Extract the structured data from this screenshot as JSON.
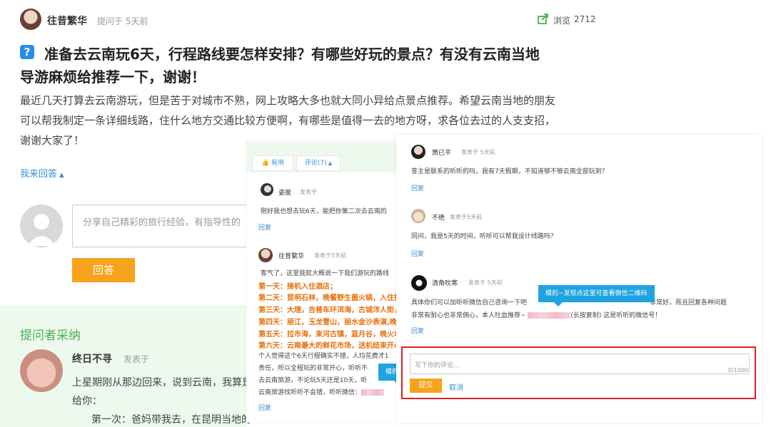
{
  "question": {
    "author": "往昔繁华",
    "asked_time": "提问于 5天前",
    "views_label": "浏览",
    "views_count": "2712",
    "title_line1": "准备去云南玩6天，行程路线要怎样安排？有哪些好玩的景点？有没有云南当地",
    "title_line2": "导游麻烦给推荐一下，谢谢！",
    "body_line1": "最近几天打算去云南游玩，但是苦于对城市不熟，网上攻略大多也就大同小异给点景点推荐。希望云南当地的朋友",
    "body_line2": "可以帮我制定一条详细线路，住什么地方交通比较方便啊，有哪些是值得一去的地方呀，求各位去过的人支支招，",
    "body_line3": "谢谢大家了！",
    "answer_toggle": "我来回答",
    "answer_placeholder": "分享自己精彩的旅行经验，有指导性的",
    "answer_button": "回答"
  },
  "adopted": {
    "section_title": "提问者采纳",
    "author": "终日不寻",
    "time": "发表于",
    "line1": "上星期刚从那边回来，说到云南，我算是",
    "line2": "给你：",
    "line3": "第一次：爸妈带我去，在昆明当地的"
  },
  "middle_panel": {
    "useful_label": "有用",
    "comments_label": "评论(7)",
    "c1": {
      "author": "姿度",
      "time": "发表于",
      "text": "刚好我也想去玩6天，能把你第二次去云南的",
      "reply": "回复"
    },
    "c2": {
      "author": "往昔繁华",
      "time": "发表于5天前",
      "intro": "客气了，这里我就大概说一下我们游玩的路线",
      "days": [
        "第一天：接机入住酒店；",
        "第二天：昆明石林，晚餐野生菌火锅，入住楚",
        "第三天：大理，吉普车环洱海，古城洋人街，",
        "第四天：丽江，玉龙雪山，丽水金沙表演,晚餐",
        "第五天：拉市海，束河古镇，蓝月谷，晚火车",
        "第六天：云南最大的鲜花市场，送机结束开心"
      ],
      "p1": "个人觉得这个6天行程确实不错，人均花费才1",
      "p2": "责任，所以全程玩的非常开心，听听不",
      "p3": "去云南旅游，不论玩5天还是10天，听",
      "p4": "云南旅游找听听不会错，听听微信：",
      "tooltip": "模的",
      "reply": "回复"
    }
  },
  "right_panel": {
    "c1": {
      "author": "萧已平",
      "time": "发表于 5天前",
      "text": "答主是联系的听听的吗，我有7天假期，不知道够不够云南全部玩到？",
      "reply": "回复"
    },
    "c2": {
      "author": "不绝",
      "time": "发表于5天前",
      "text": "同问，我是5天的时间，听听可以帮我设计线路吗？",
      "reply": "回复"
    },
    "c3": {
      "author": "清角吹寒",
      "time": "发表于 5天前",
      "tooltip": "模的~发现点这里可查看微信二维码",
      "line1a": "具体你们可以加听听微信自己咨询一下吧",
      "line1b": "非常好，而且回复各种问题",
      "line2a": "非常有耐心也非常佣心，本人吐血推荐~",
      "line2b": "(长按复制)  这是听听的微信号！",
      "reply": "回复"
    },
    "comment_box": {
      "placeholder": "写下你的评论...",
      "counter": "0/1000",
      "submit": "提交",
      "cancel": "取消"
    }
  },
  "colors": {
    "accent_blue": "#3a8fd6",
    "orange": "#f7a21b",
    "red_outline": "#e02020",
    "green_bg": "#eef9ee",
    "green_text": "#4caf50"
  }
}
